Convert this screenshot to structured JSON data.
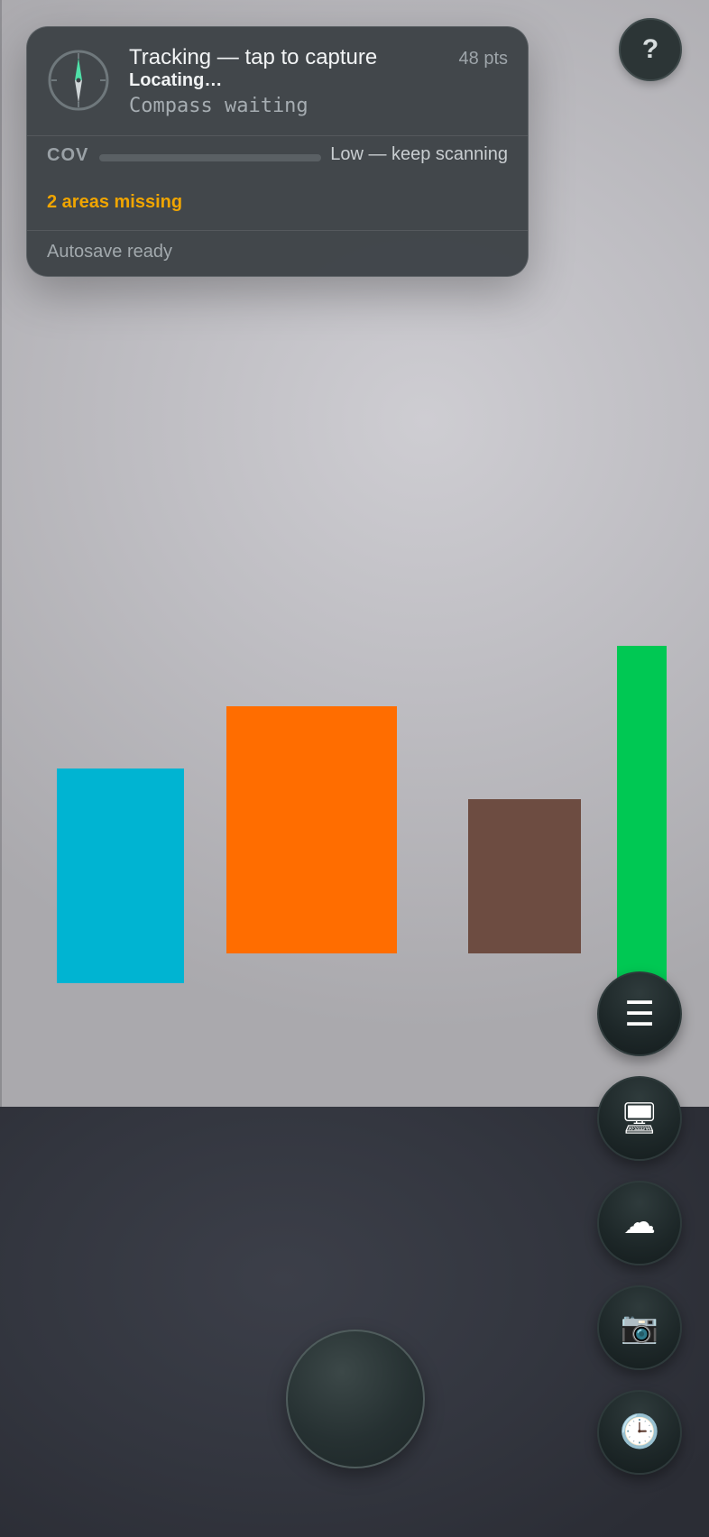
{
  "hud": {
    "title": "Tracking — tap to capture",
    "points": "48 pts",
    "locating": "Locating…",
    "compass_status": "Compass waiting",
    "coverage": {
      "label": "COV",
      "progress_fraction": 0.0,
      "status": "Low — keep scanning"
    },
    "missing": "2 areas missing",
    "autosave": "Autosave ready"
  },
  "help_button": {
    "label": "?"
  },
  "tool_buttons": [
    {
      "name": "menu",
      "icon": "menu-icon",
      "glyph": "☰"
    },
    {
      "name": "device",
      "icon": "device-icon",
      "glyph": "🖥"
    },
    {
      "name": "cloud",
      "icon": "cloud-icon",
      "glyph": "☁"
    },
    {
      "name": "camera",
      "icon": "camera-icon",
      "glyph": "📷"
    },
    {
      "name": "history",
      "icon": "clock-icon",
      "glyph": "🕒"
    }
  ],
  "colors": {
    "accent_warning": "#f0a500",
    "object_cyan": "#00b4d2",
    "object_orange": "#ff6d00",
    "object_brown": "#6d4c41",
    "object_green": "#00c853",
    "compass_needle": "#4fe0a8"
  }
}
